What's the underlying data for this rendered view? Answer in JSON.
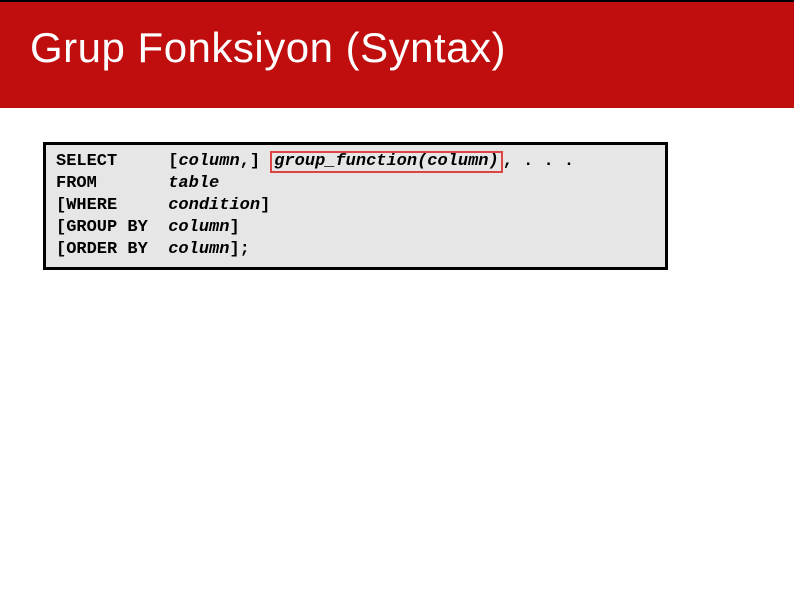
{
  "title": "Grup Fonksiyon (Syntax)",
  "code": {
    "kw_select": "SELECT",
    "select_col_prefix": "[",
    "select_col": "column",
    "select_col_suffix": ",]",
    "group_fn": "group_function(column)",
    "select_trail": ", . . .",
    "kw_from": "FROM",
    "from_val": "table",
    "kw_where": "[WHERE",
    "where_val": "condition",
    "where_close": "]",
    "kw_groupby": "[GROUP BY",
    "group_val": "column",
    "group_close": "]",
    "kw_orderby": "[ORDER BY",
    "order_val": "column",
    "order_close": "];"
  }
}
